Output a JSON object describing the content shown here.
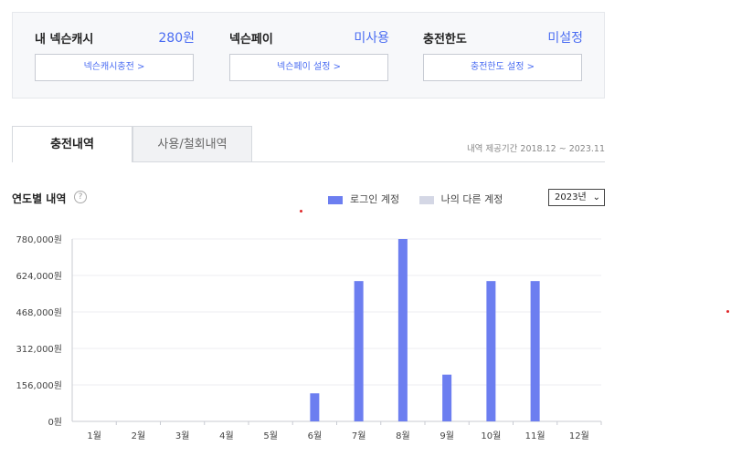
{
  "summary": {
    "cash": {
      "label": "내 넥슨캐시",
      "value": "280원",
      "button": "넥슨캐시충전 >"
    },
    "pay": {
      "label": "넥슨페이",
      "value": "미사용",
      "button": "넥슨페이 설정 >"
    },
    "limit": {
      "label": "충전한도",
      "value": "미설정",
      "button": "충전한도 설정 >"
    }
  },
  "tabs": [
    {
      "label": "충전내역",
      "active": true
    },
    {
      "label": "사용/철회내역",
      "active": false
    }
  ],
  "period": "내역 제공기간 2018.12 ~ 2023.11",
  "section": {
    "title": "연도별 내역",
    "help": "?"
  },
  "legend": [
    {
      "label": "로그인 계정",
      "color": "#6c7ef0"
    },
    {
      "label": "나의 다른 계정",
      "color": "#d4d7e5"
    }
  ],
  "year_select": {
    "value": "2023년"
  },
  "chart_data": {
    "type": "bar",
    "categories": [
      "1월",
      "2월",
      "3월",
      "4월",
      "5월",
      "6월",
      "7월",
      "8월",
      "9월",
      "10월",
      "11월",
      "12월"
    ],
    "series": [
      {
        "name": "로그인 계정",
        "color": "#6c7ef0",
        "values": [
          0,
          0,
          0,
          0,
          0,
          120000,
          600000,
          780000,
          200000,
          600000,
          600000,
          0
        ]
      }
    ],
    "ylim": [
      0,
      780000
    ],
    "yticks": [
      0,
      156000,
      312000,
      468000,
      624000,
      780000
    ],
    "ytick_labels": [
      "0원",
      "156,000원",
      "312,000원",
      "468,000원",
      "624,000원",
      "780,000원"
    ],
    "grid": true,
    "legend_position": "top-right"
  }
}
